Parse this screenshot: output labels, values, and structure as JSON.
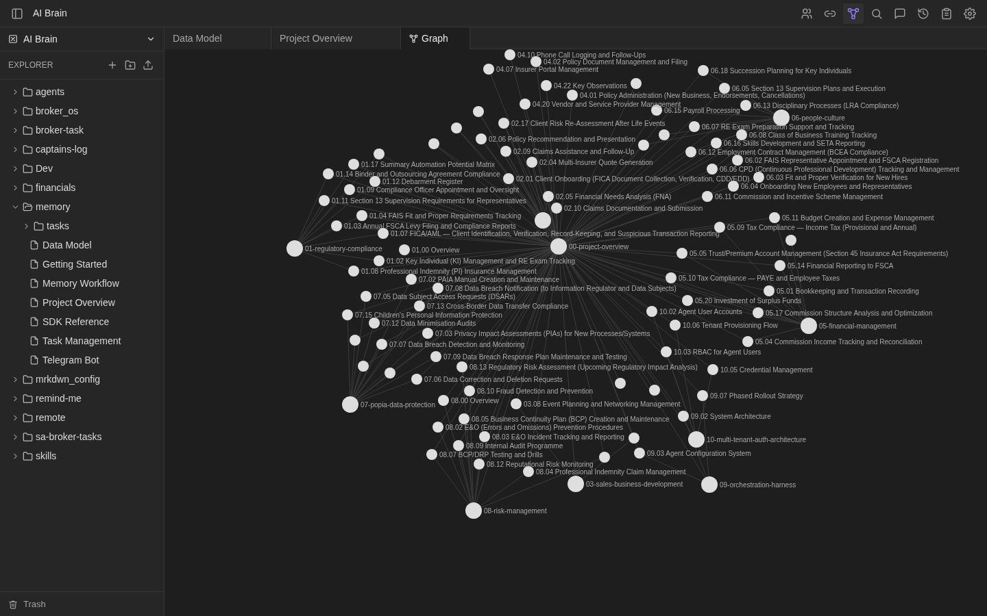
{
  "window": {
    "title": "AI Brain"
  },
  "toolbar": [
    {
      "kind": "people",
      "selected": false
    },
    {
      "kind": "link",
      "selected": false
    },
    {
      "kind": "graph",
      "selected": true
    },
    {
      "kind": "search",
      "selected": false
    },
    {
      "kind": "chat",
      "selected": false
    },
    {
      "kind": "history",
      "selected": false
    },
    {
      "kind": "clipboard",
      "selected": false
    },
    {
      "kind": "settings",
      "selected": false
    }
  ],
  "vault": {
    "name": "AI Brain"
  },
  "explorer": {
    "title": "EXPLORER"
  },
  "tree": [
    {
      "label": "agents",
      "kind": "folder",
      "expanded": false
    },
    {
      "label": "broker_os",
      "kind": "folder",
      "expanded": false
    },
    {
      "label": "broker-task",
      "kind": "folder",
      "expanded": false
    },
    {
      "label": "captains-log",
      "kind": "folder",
      "expanded": false
    },
    {
      "label": "Dev",
      "kind": "folder",
      "expanded": false
    },
    {
      "label": "financials",
      "kind": "folder",
      "expanded": false
    },
    {
      "label": "memory",
      "kind": "folder",
      "expanded": true,
      "children": [
        {
          "label": "tasks",
          "kind": "folder",
          "expanded": false
        },
        {
          "label": "Data Model",
          "kind": "file"
        },
        {
          "label": "Getting Started",
          "kind": "file"
        },
        {
          "label": "Memory Workflow",
          "kind": "file"
        },
        {
          "label": "Project Overview",
          "kind": "file"
        },
        {
          "label": "SDK Reference",
          "kind": "file"
        },
        {
          "label": "Task Management",
          "kind": "file"
        },
        {
          "label": "Telegram Bot",
          "kind": "file"
        }
      ]
    },
    {
      "label": "mrkdwn_config",
      "kind": "folder",
      "expanded": false
    },
    {
      "label": "remind-me",
      "kind": "folder",
      "expanded": false
    },
    {
      "label": "remote",
      "kind": "folder",
      "expanded": false
    },
    {
      "label": "sa-broker-tasks",
      "kind": "folder",
      "expanded": false
    },
    {
      "label": "skills",
      "kind": "folder",
      "expanded": false
    }
  ],
  "trash": {
    "label": "Trash"
  },
  "tabs": [
    {
      "label": "Data Model",
      "kind": "note",
      "selected": false
    },
    {
      "label": "Project Overview",
      "kind": "note",
      "selected": false
    },
    {
      "label": "Graph",
      "kind": "graph",
      "selected": true
    }
  ],
  "graph": {
    "center": {
      "label": "00-project-overview"
    },
    "groups": [
      {
        "notes": [
          {
            "label": "04.10 Phone Call Logging and Follow-Ups"
          },
          {
            "label": "04.02 Policy Document Management and Filing"
          },
          {
            "label": "04.07 Insurer Portal Management"
          },
          {
            "label": "04.22 Key Observations"
          },
          {
            "label": "04.01 Policy Administration (New Business, Endorsements, Cancellations)"
          },
          {
            "label": "04.20 Vendor and Service Provider Management"
          }
        ]
      },
      {
        "label": "06-people-culture",
        "notes": [
          {
            "label": "06.18 Succession Planning for Key Individuals"
          },
          {
            "label": "06.05 Section 13 Supervision Plans and Execution"
          },
          {
            "label": "06.13 Disciplinary Processes (LRA Compliance)"
          },
          {
            "label": "06.15 Payroll Processing"
          },
          {
            "label": "06.07 RE Exam Preparation Support and Tracking"
          },
          {
            "label": "06.08 Class of Business Training Tracking"
          },
          {
            "label": "06.16 Skills Development and SETA Reporting"
          },
          {
            "label": "06.12 Employment Contract Management (BCEA Compliance)"
          },
          {
            "label": "06.02 FAIS Representative Appointment and FSCA Registration"
          },
          {
            "label": "06.06 CPD (Continuous Professional Development) Tracking and Management"
          },
          {
            "label": "06.03 Fit and Proper Verification for New Hires"
          },
          {
            "label": "06.04 Onboarding New Employees and Representatives"
          },
          {
            "label": "06.11 Commission and Incentive Scheme Management"
          }
        ]
      },
      {
        "notes": [
          {
            "label": "02.17 Client Risk Re-Assessment After Life Events"
          },
          {
            "label": "02.06 Policy Recommendation and Presentation"
          },
          {
            "label": "02.09 Claims Assistance and Follow-Up"
          },
          {
            "label": "02.04 Multi-Insurer Quote Generation"
          },
          {
            "label": "02.01 Client Onboarding (FICA Document Collection, Verification, CDD/EDD)"
          },
          {
            "label": "02.05 Financial Needs Analysis (FNA)"
          },
          {
            "label": "02.10 Claims Documentation and Submission"
          }
        ]
      },
      {
        "label": "01-regulatory-compliance",
        "notes": [
          {
            "label": "01.17 Summary Automation Potential Matrix"
          },
          {
            "label": "01.14 Binder and Outsourcing Agreement Compliance"
          },
          {
            "label": "01.12 Debarment Register"
          },
          {
            "label": "01.09 Compliance Officer Appointment and Oversight"
          },
          {
            "label": "01.11 Section 13 Supervision Requirements for Representatives"
          },
          {
            "label": "01.04 FAIS Fit and Proper Requirements Tracking"
          },
          {
            "label": "01.03 Annual FSCA Levy Filing and Compliance Reports"
          },
          {
            "label": "01.07 FICA/AML — Client Identification, Verification, Record-Keeping, and Suspicious Transaction Reporting"
          },
          {
            "label": "01.00 Overview"
          },
          {
            "label": "01.02 Key Individual (KI) Management and RE Exam Tracking"
          },
          {
            "label": "01.08 Professional Indemnity (PI) Insurance Management"
          }
        ]
      },
      {
        "label": "05-financial-management",
        "notes": [
          {
            "label": "05.11 Budget Creation and Expense Management"
          },
          {
            "label": "05.09 Tax Compliance — Income Tax (Provisional and Annual)"
          },
          {
            "label": "05.05 Trust/Premium Account Management (Section 45 Insurance Act Requirements)"
          },
          {
            "label": "05.14 Financial Reporting to FSCA"
          },
          {
            "label": "05.10 Tax Compliance — PAYE and Employee Taxes"
          },
          {
            "label": "05.01 Bookkeeping and Transaction Recording"
          },
          {
            "label": "05.20 Investment of Surplus Funds"
          },
          {
            "label": "05.17 Commission Structure Analysis and Optimization"
          },
          {
            "label": "05.04 Commission Income Tracking and Reconciliation"
          }
        ]
      },
      {
        "label": "07-popia-data-protection",
        "notes": [
          {
            "label": "07.02 PAIA Manual Creation and Maintenance"
          },
          {
            "label": "07.08 Data Breach Notification (to Information Regulator and Data Subjects)"
          },
          {
            "label": "07.05 Data Subject Access Requests (DSARs)"
          },
          {
            "label": "07.13 Cross-Border Data Transfer Compliance"
          },
          {
            "label": "07.15 Children's Personal Information Protection"
          },
          {
            "label": "07.12 Data Minimisation Audits"
          },
          {
            "label": "07.03 Privacy Impact Assessments (PIAs) for New Processes/Systems"
          },
          {
            "label": "07.07 Data Breach Detection and Monitoring"
          },
          {
            "label": "07.09 Data Breach Response Plan Maintenance and Testing"
          },
          {
            "label": "07.06 Data Correction and Deletion Requests"
          }
        ]
      },
      {
        "label": "10-multi-tenant-auth-architecture",
        "notes": [
          {
            "label": "10.02 Agent User Accounts"
          },
          {
            "label": "10.06 Tenant Provisioning Flow"
          },
          {
            "label": "10.03 RBAC for Agent Users"
          },
          {
            "label": "10.05 Credential Management"
          }
        ]
      },
      {
        "label": "08-risk-management",
        "notes": [
          {
            "label": "08.13 Regulatory Risk Assessment (Upcoming Regulatory Impact Analysis)"
          },
          {
            "label": "08.10 Fraud Detection and Prevention"
          },
          {
            "label": "08.00 Overview"
          },
          {
            "label": "08.05 Business Continuity Plan (BCP) Creation and Maintenance"
          },
          {
            "label": "08.02 E&O (Errors and Omissions) Prevention Procedures"
          },
          {
            "label": "08.03 E&O Incident Tracking and Reporting"
          },
          {
            "label": "08.09 Internal Audit Programme"
          },
          {
            "label": "08.07 BCP/DRP Testing and Drills"
          },
          {
            "label": "08.12 Reputational Risk Monitoring"
          },
          {
            "label": "08.04 Professional Indemnity Claim Management"
          }
        ]
      },
      {
        "label": "03-sales-business-development",
        "notes": [
          {
            "label": "03.08 Event Planning and Networking Management"
          }
        ]
      },
      {
        "label": "09-orchestration-harness",
        "notes": [
          {
            "label": "09.07 Phased Rollout Strategy"
          },
          {
            "label": "09.02 System Architecture"
          },
          {
            "label": "09.03 Agent Configuration System"
          }
        ]
      }
    ]
  }
}
